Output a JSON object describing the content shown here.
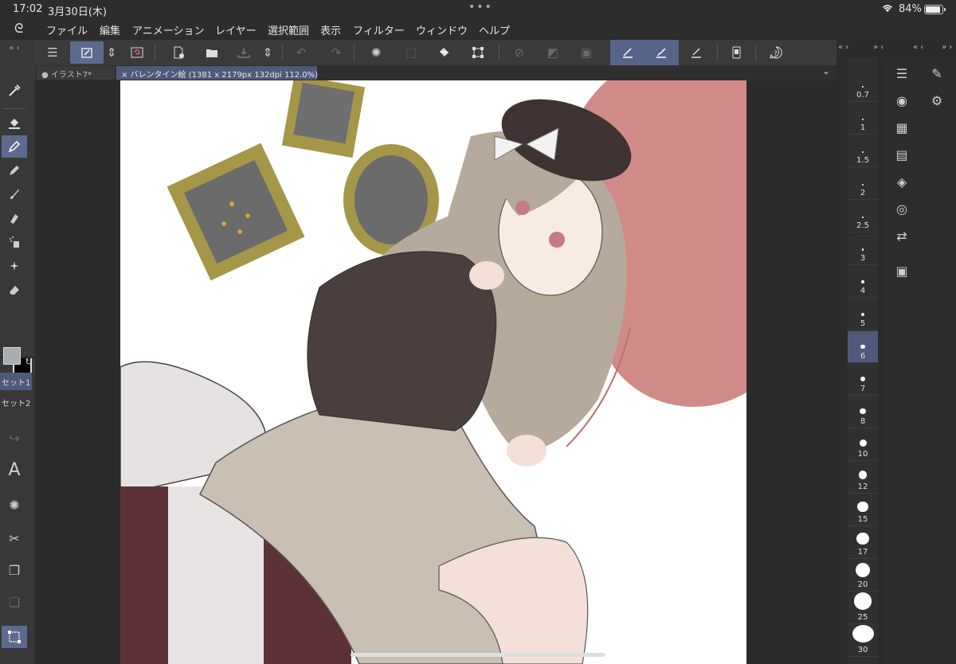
{
  "status": {
    "time": "17:02",
    "date": "3月30日(木)",
    "battery": "84%"
  },
  "menu": [
    "ファイル",
    "編集",
    "アニメーション",
    "レイヤー",
    "選択範囲",
    "表示",
    "フィルター",
    "ウィンドウ",
    "ヘルプ"
  ],
  "tabs": {
    "inactive": "● イラスト7*",
    "active": "× バレンタイン絵 (1381 x 2179px 132dpi 112.0%)"
  },
  "left_sets": {
    "set1": "セット1",
    "set2": "セット2"
  },
  "brush_sizes": [
    "0.7",
    "1",
    "1.5",
    "2",
    "2.5",
    "3",
    "4",
    "5",
    "6",
    "7",
    "8",
    "10",
    "12",
    "15",
    "17",
    "20",
    "25",
    "30"
  ],
  "brush_size_selected": "6",
  "colors": {
    "main": "#a9adb1",
    "sub": "#000000",
    "accent": "#5d6a8f"
  },
  "icons": {
    "command_bar": [
      "menu-icon",
      "quick-access-icon",
      "chevron-updown-icon",
      "spiral-icon",
      "new-icon",
      "open-icon",
      "save-icon",
      "undo-icon",
      "redo-icon",
      "loading-icon",
      "select-icon",
      "fill-icon",
      "transform-icon",
      "clear-icon",
      "selection-layer-icon",
      "frame-icon",
      "pen-ruler-icon",
      "brush-ruler-icon",
      "ruler-icon",
      "phone-icon",
      "help-icon"
    ]
  }
}
